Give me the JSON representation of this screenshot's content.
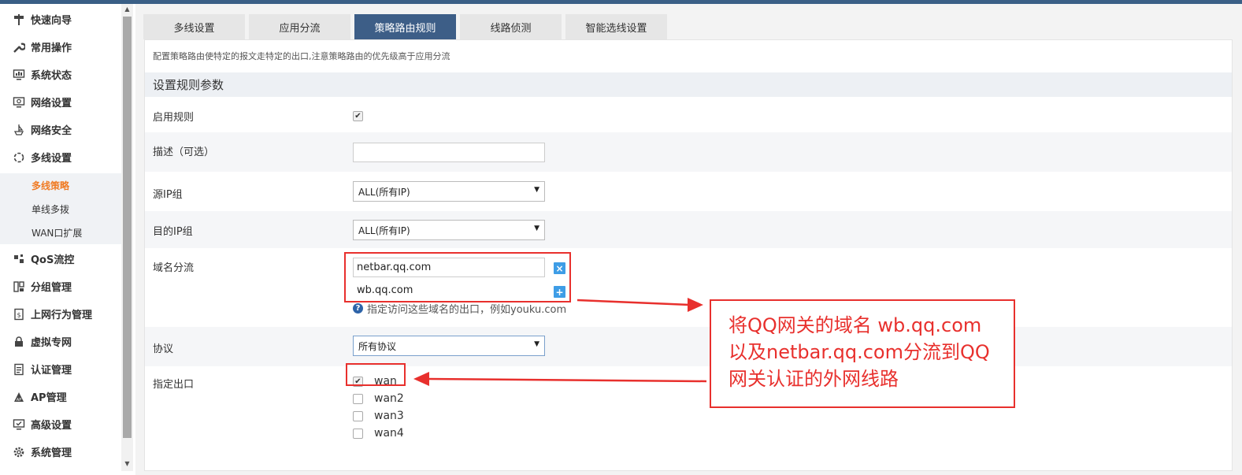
{
  "sidebar": {
    "items": [
      {
        "label": "快速向导",
        "icon": "signpost-icon"
      },
      {
        "label": "常用操作",
        "icon": "wrench-icon"
      },
      {
        "label": "系统状态",
        "icon": "monitor-chart-icon"
      },
      {
        "label": "网络设置",
        "icon": "network-monitor-icon"
      },
      {
        "label": "网络安全",
        "icon": "shield-ship-icon"
      },
      {
        "label": "多线设置",
        "icon": "multiline-ring-icon"
      }
    ],
    "sub_items": [
      {
        "label": "多线策略",
        "active": true
      },
      {
        "label": "单线多拨"
      },
      {
        "label": "WAN口扩展"
      }
    ],
    "items2": [
      {
        "label": "QoS流控",
        "icon": "qos-icon"
      },
      {
        "label": "分组管理",
        "icon": "group-icon"
      },
      {
        "label": "上网行为管理",
        "icon": "behavior-doc-icon"
      },
      {
        "label": "虚拟专网",
        "icon": "lock-icon"
      },
      {
        "label": "认证管理",
        "icon": "auth-doc-icon"
      },
      {
        "label": "AP管理",
        "icon": "ap-icon"
      },
      {
        "label": "高级设置",
        "icon": "advanced-monitor-icon"
      },
      {
        "label": "系统管理",
        "icon": "gear-icon"
      }
    ]
  },
  "tabs": [
    "多线设置",
    "应用分流",
    "策略路由规则",
    "线路侦测",
    "智能选线设置"
  ],
  "active_tab": "策略路由规则",
  "description": "配置策略路由使特定的报文走特定的出口,注意策略路由的优先级高于应用分流",
  "section_title": "设置规则参数",
  "form": {
    "enable_label": "启用规则",
    "enable_checked": true,
    "desc_label": "描述（可选）",
    "desc_value": "",
    "src_ip_label": "源IP组",
    "src_ip_value": "ALL(所有IP)",
    "dst_ip_label": "目的IP组",
    "dst_ip_value": "ALL(所有IP)",
    "domain_label": "域名分流",
    "domains": [
      "netbar.qq.com",
      "wb.qq.com"
    ],
    "domain_remove_symbol": "×",
    "domain_add_symbol": "+",
    "domain_help": "指定访问这些域名的出口，例如youku.com",
    "help_symbol": "?",
    "protocol_label": "协议",
    "protocol_value": "所有协议",
    "exit_label": "指定出口",
    "exits": [
      {
        "label": "wan",
        "checked": true
      },
      {
        "label": "wan2",
        "checked": false
      },
      {
        "label": "wan3",
        "checked": false
      },
      {
        "label": "wan4",
        "checked": false
      }
    ]
  },
  "annotation": {
    "lines": [
      "将QQ网关的域名 wb.qq.com",
      "以及netbar.qq.com分流到QQ",
      "网关认证的外网线路"
    ]
  },
  "colors": {
    "accent": "#3d5e87",
    "active_sub": "#f07b24",
    "annotation_red": "#e8302d",
    "button_blue": "#3e9de6"
  }
}
